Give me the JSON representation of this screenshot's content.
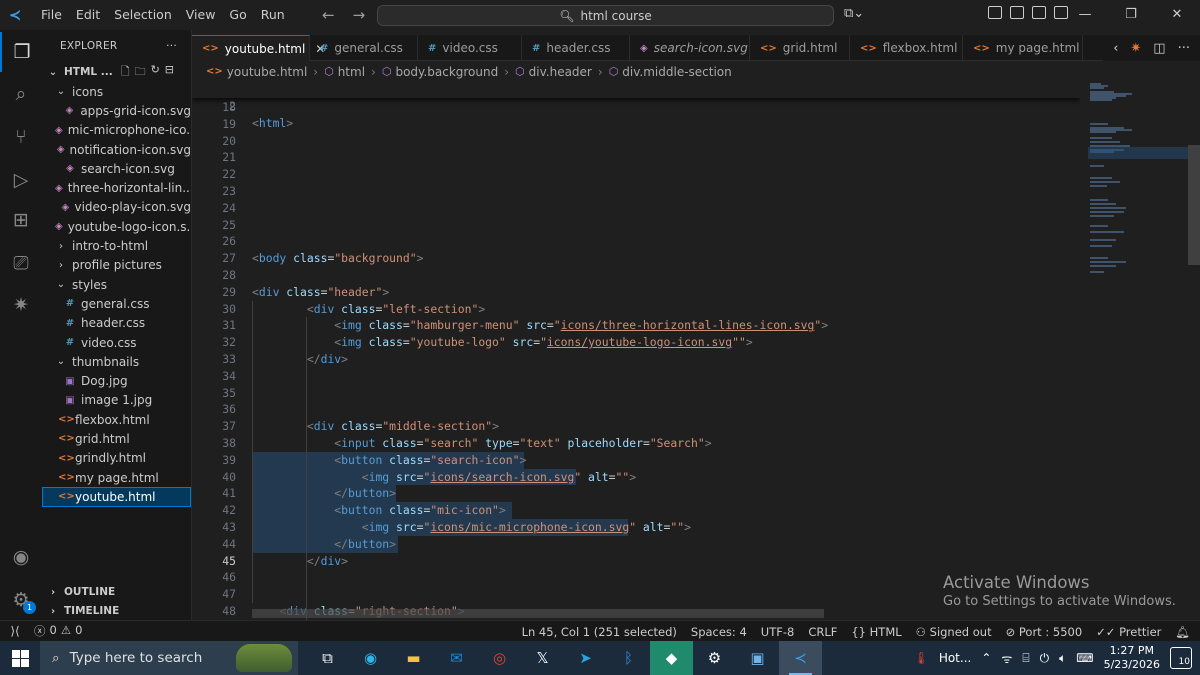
{
  "menu": [
    "File",
    "Edit",
    "Selection",
    "View",
    "Go",
    "Run"
  ],
  "command_center": {
    "text": "html course"
  },
  "explorer": {
    "title": "EXPLORER",
    "root": "HTML ...",
    "items": [
      {
        "label": "icons",
        "type": "folder-open",
        "indent": 1
      },
      {
        "label": "apps-grid-icon.svg",
        "type": "svg",
        "indent": 2
      },
      {
        "label": "mic-microphone-ico...",
        "type": "svg",
        "indent": 2
      },
      {
        "label": "notification-icon.svg",
        "type": "svg",
        "indent": 2
      },
      {
        "label": "search-icon.svg",
        "type": "svg",
        "indent": 2
      },
      {
        "label": "three-horizontal-lin...",
        "type": "svg",
        "indent": 2
      },
      {
        "label": "video-play-icon.svg",
        "type": "svg",
        "indent": 2
      },
      {
        "label": "youtube-logo-icon.s...",
        "type": "svg",
        "indent": 2
      },
      {
        "label": "intro-to-html",
        "type": "folder",
        "indent": 1
      },
      {
        "label": "profile pictures",
        "type": "folder",
        "indent": 1
      },
      {
        "label": "styles",
        "type": "folder-open",
        "indent": 1
      },
      {
        "label": "general.css",
        "type": "css",
        "indent": 2
      },
      {
        "label": "header.css",
        "type": "css",
        "indent": 2
      },
      {
        "label": "video.css",
        "type": "css",
        "indent": 2
      },
      {
        "label": "thumbnails",
        "type": "folder-open",
        "indent": 1
      },
      {
        "label": "Dog.jpg",
        "type": "img",
        "indent": 2
      },
      {
        "label": "image 1.jpg",
        "type": "img",
        "indent": 2
      },
      {
        "label": "flexbox.html",
        "type": "html",
        "indent": 1
      },
      {
        "label": "grid.html",
        "type": "html",
        "indent": 1
      },
      {
        "label": "grindly.html",
        "type": "html",
        "indent": 1
      },
      {
        "label": "my page.html",
        "type": "html",
        "indent": 1
      },
      {
        "label": "youtube.html",
        "type": "html",
        "indent": 1,
        "selected": true
      }
    ],
    "outline": "OUTLINE",
    "timeline": "TIMELINE"
  },
  "tabs": [
    {
      "label": "youtube.html",
      "type": "html",
      "active": true
    },
    {
      "label": "general.css",
      "type": "css"
    },
    {
      "label": "video.css",
      "type": "css"
    },
    {
      "label": "header.css",
      "type": "css"
    },
    {
      "label": "search-icon.svg",
      "type": "svg",
      "italic": true
    },
    {
      "label": "grid.html",
      "type": "html"
    },
    {
      "label": "flexbox.html",
      "type": "html"
    },
    {
      "label": "my page.html",
      "type": "html"
    }
  ],
  "breadcrumb": [
    "youtube.html",
    "html",
    "body.background",
    "div.header",
    "div.middle-section"
  ],
  "editor": {
    "sticky": {
      "ln": "2",
      "code": [
        [
          "t-pun",
          "<"
        ],
        [
          "t-tag",
          "html"
        ],
        [
          "t-pun",
          ">"
        ]
      ]
    },
    "lines": [
      {
        "ln": "18",
        "code": []
      },
      {
        "ln": "19",
        "code": []
      },
      {
        "ln": "20",
        "code": []
      },
      {
        "ln": "21",
        "code": []
      },
      {
        "ln": "22",
        "code": []
      },
      {
        "ln": "23",
        "code": []
      },
      {
        "ln": "24",
        "code": []
      },
      {
        "ln": "25",
        "code": []
      },
      {
        "ln": "26",
        "code": []
      },
      {
        "ln": "27",
        "code": [
          [
            "t-pun",
            "<"
          ],
          [
            "t-tag",
            "body"
          ],
          [
            "",
            ""
          ],
          [
            "t-attr",
            " class"
          ],
          [
            "",
            "="
          ],
          [
            "t-str",
            "\"background\""
          ],
          [
            "t-pun",
            ">"
          ]
        ]
      },
      {
        "ln": "28",
        "code": []
      },
      {
        "ln": "29",
        "code": [
          [
            "t-pun",
            "<"
          ],
          [
            "t-tag",
            "div"
          ],
          [
            "t-attr",
            " class"
          ],
          [
            "",
            "="
          ],
          [
            "t-str",
            "\"header\""
          ],
          [
            "t-pun",
            ">"
          ]
        ]
      },
      {
        "ln": "30",
        "code": [
          [
            "",
            "        "
          ],
          [
            "t-pun",
            "<"
          ],
          [
            "t-tag",
            "div"
          ],
          [
            "t-attr",
            " class"
          ],
          [
            "",
            "="
          ],
          [
            "t-str",
            "\"left-section\""
          ],
          [
            "t-pun",
            ">"
          ]
        ]
      },
      {
        "ln": "31",
        "code": [
          [
            "",
            "            "
          ],
          [
            "t-pun",
            "<"
          ],
          [
            "t-tag",
            "img"
          ],
          [
            "t-attr",
            " class"
          ],
          [
            "",
            "="
          ],
          [
            "t-str",
            "\"hamburger-menu\""
          ],
          [
            "t-attr",
            " src"
          ],
          [
            "",
            "="
          ],
          [
            "t-str",
            "\""
          ],
          [
            "t-link",
            "icons/three-horizontal-lines-icon.svg"
          ],
          [
            "t-str",
            "\""
          ],
          [
            "t-pun",
            ">"
          ]
        ]
      },
      {
        "ln": "32",
        "code": [
          [
            "",
            "            "
          ],
          [
            "t-pun",
            "<"
          ],
          [
            "t-tag",
            "img"
          ],
          [
            "t-attr",
            " class"
          ],
          [
            "",
            "="
          ],
          [
            "t-str",
            "\"youtube-logo\""
          ],
          [
            "t-attr",
            " src"
          ],
          [
            "",
            "="
          ],
          [
            "t-str",
            "\""
          ],
          [
            "t-link",
            "icons/youtube-logo-icon.svg"
          ],
          [
            "t-str",
            "\"\""
          ],
          [
            "t-pun",
            ">"
          ]
        ]
      },
      {
        "ln": "33",
        "code": [
          [
            "",
            "        "
          ],
          [
            "t-pun",
            "</"
          ],
          [
            "t-tag",
            "div"
          ],
          [
            "t-pun",
            ">"
          ]
        ]
      },
      {
        "ln": "34",
        "code": []
      },
      {
        "ln": "35",
        "code": []
      },
      {
        "ln": "36",
        "code": []
      },
      {
        "ln": "37",
        "code": [
          [
            "",
            "        "
          ],
          [
            "t-pun",
            "<"
          ],
          [
            "t-tag",
            "div"
          ],
          [
            "t-attr",
            " class"
          ],
          [
            "",
            "="
          ],
          [
            "t-str",
            "\"middle-section\""
          ],
          [
            "t-pun",
            ">"
          ]
        ]
      },
      {
        "ln": "38",
        "code": [
          [
            "",
            "            "
          ],
          [
            "t-pun",
            "<"
          ],
          [
            "t-tag",
            "input"
          ],
          [
            "t-attr",
            " class"
          ],
          [
            "",
            "="
          ],
          [
            "t-str",
            "\"search\""
          ],
          [
            "t-attr",
            " type"
          ],
          [
            "",
            "="
          ],
          [
            "t-str",
            "\"text\""
          ],
          [
            "t-attr",
            " placeholder"
          ],
          [
            "",
            "="
          ],
          [
            "t-str",
            "\"Search\""
          ],
          [
            "t-pun",
            ">"
          ]
        ]
      },
      {
        "ln": "39",
        "code": [
          [
            "",
            "            "
          ],
          [
            "t-pun",
            "<"
          ],
          [
            "t-tag",
            "button"
          ],
          [
            "t-attr",
            " class"
          ],
          [
            "",
            "="
          ],
          [
            "t-str",
            "\"search-icon\""
          ],
          [
            "t-pun",
            ">"
          ]
        ]
      },
      {
        "ln": "40",
        "code": [
          [
            "",
            "                "
          ],
          [
            "t-pun",
            "<"
          ],
          [
            "t-tag",
            "img"
          ],
          [
            "t-attr",
            " src"
          ],
          [
            "",
            "="
          ],
          [
            "t-str",
            "\""
          ],
          [
            "t-link",
            "icons/search-icon.svg"
          ],
          [
            "t-str",
            "\""
          ],
          [
            "t-attr",
            " alt"
          ],
          [
            "",
            "="
          ],
          [
            "t-str",
            "\"\""
          ],
          [
            "t-pun",
            ">"
          ]
        ]
      },
      {
        "ln": "41",
        "code": [
          [
            "",
            "            "
          ],
          [
            "t-pun",
            "</"
          ],
          [
            "t-tag",
            "button"
          ],
          [
            "t-pun",
            ">"
          ]
        ]
      },
      {
        "ln": "42",
        "code": [
          [
            "",
            "            "
          ],
          [
            "t-pun",
            "<"
          ],
          [
            "t-tag",
            "button"
          ],
          [
            "t-attr",
            " class"
          ],
          [
            "",
            "="
          ],
          [
            "t-str",
            "\"mic-icon\""
          ],
          [
            "t-pun",
            ">"
          ]
        ]
      },
      {
        "ln": "43",
        "code": [
          [
            "",
            "                "
          ],
          [
            "t-pun",
            "<"
          ],
          [
            "t-tag",
            "img"
          ],
          [
            "t-attr",
            " src"
          ],
          [
            "",
            "="
          ],
          [
            "t-str",
            "\""
          ],
          [
            "t-link",
            "icons/mic-microphone-icon.svg"
          ],
          [
            "t-str",
            "\""
          ],
          [
            "t-attr",
            " alt"
          ],
          [
            "",
            "="
          ],
          [
            "t-str",
            "\"\""
          ],
          [
            "t-pun",
            ">"
          ]
        ]
      },
      {
        "ln": "44",
        "code": [
          [
            "",
            "            "
          ],
          [
            "t-pun",
            "</"
          ],
          [
            "t-tag",
            "button"
          ],
          [
            "t-pun",
            ">"
          ]
        ]
      },
      {
        "ln": "45",
        "code": [
          [
            "",
            "        "
          ],
          [
            "t-pun",
            "</"
          ],
          [
            "t-tag",
            "div"
          ],
          [
            "t-pun",
            ">"
          ]
        ],
        "current": true
      },
      {
        "ln": "46",
        "code": []
      },
      {
        "ln": "47",
        "code": []
      },
      {
        "ln": "48",
        "code": [
          [
            "",
            "    "
          ],
          [
            "t-pun",
            "<"
          ],
          [
            "t-tag",
            "div"
          ],
          [
            "t-attr",
            " class"
          ],
          [
            "",
            "="
          ],
          [
            "t-str",
            "\"right-section\""
          ],
          [
            "t-pun",
            ">"
          ]
        ]
      }
    ],
    "selected_lines": [
      "39",
      "40",
      "41",
      "42",
      "43",
      "44"
    ]
  },
  "watermark": {
    "title": "Activate Windows",
    "subtitle": "Go to Settings to activate Windows."
  },
  "statusbar": {
    "errors": "0",
    "warnings": "0",
    "position": "Ln 45, Col 1 (251 selected)",
    "spaces": "Spaces: 4",
    "encoding": "UTF-8",
    "eol": "CRLF",
    "language": "HTML",
    "account": "Signed out",
    "port": "Port : 5500",
    "prettier": "Prettier"
  },
  "taskbar": {
    "search_placeholder": "Type here to search",
    "weather": "Hot...",
    "time": "1:27 PM",
    "date": "5/23/2026",
    "notifications": "10"
  },
  "colors": {
    "accent": "#0078d4",
    "selection": "#264f78"
  }
}
